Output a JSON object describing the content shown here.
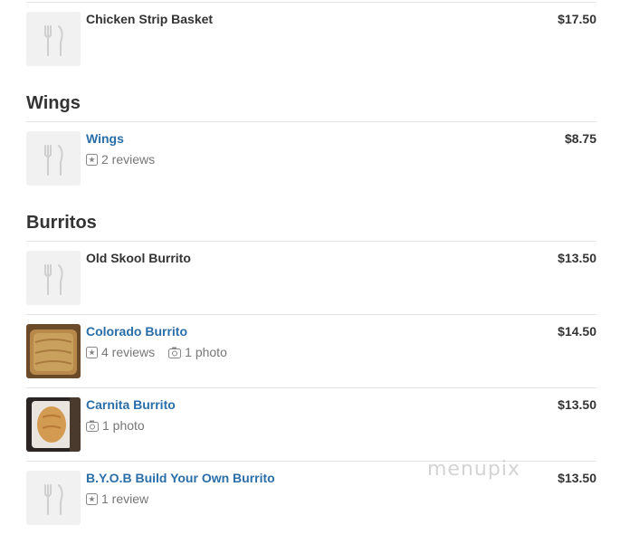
{
  "sections": [
    {
      "title": "",
      "items": [
        {
          "name": "Chicken Strip Basket",
          "price": "$17.50",
          "image": "utensils-placeholder-icon",
          "linked": false
        }
      ]
    },
    {
      "title": "Wings",
      "items": [
        {
          "name": "Wings",
          "price": "$8.75",
          "image": "utensils-placeholder-icon",
          "linked": true,
          "reviews": "2 reviews"
        }
      ]
    },
    {
      "title": "Burritos",
      "items": [
        {
          "name": "Old Skool Burrito",
          "price": "$13.50",
          "image": "utensils-placeholder-icon",
          "linked": false
        },
        {
          "name": "Colorado Burrito",
          "price": "$14.50",
          "image": "food-photo",
          "linked": true,
          "reviews": "4 reviews",
          "photos": "1 photo"
        },
        {
          "name": "Carnita Burrito",
          "price": "$13.50",
          "image": "food-photo",
          "linked": true,
          "photos": "1 photo"
        },
        {
          "name": "B.Y.O.B Build Your Own Burrito",
          "price": "$13.50",
          "image": "utensils-placeholder-icon",
          "linked": true,
          "reviews": "1 review"
        }
      ]
    }
  ],
  "watermark": "menupix",
  "colors": {
    "link": "#2a6ea8",
    "text": "#333333",
    "muted": "#777777",
    "rule": "#e3e3e3"
  }
}
